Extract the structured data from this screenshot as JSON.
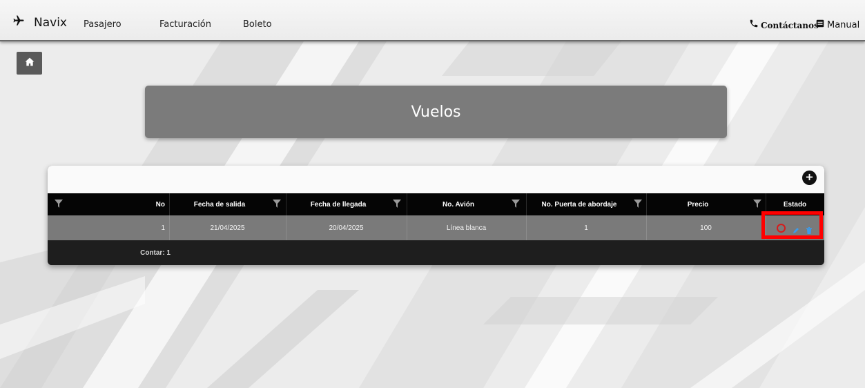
{
  "navbar": {
    "brand": "Navix",
    "links": [
      "Pasajero",
      "Facturación",
      "Boleto"
    ],
    "contact_label": "Contáctanos",
    "manual_label": "Manual"
  },
  "page": {
    "title": "Vuelos"
  },
  "grid": {
    "columns": [
      "No",
      "Fecha de salida",
      "Fecha de llegada",
      "No. Avión",
      "No. Puerta de abordaje",
      "Precio",
      "Estado"
    ],
    "rows": [
      {
        "no": "1",
        "fecha_salida": "21/04/2025",
        "fecha_llegada": "20/04/2025",
        "avion": "Línea blanca",
        "puerta": "1",
        "precio": "100"
      }
    ],
    "footer_count": "Contar: 1"
  },
  "icons": {
    "brand": "airplane-icon",
    "contact": "phone-icon",
    "manual": "book-icon",
    "home": "home-icon",
    "add": "plus-circle-icon",
    "filter": "filter-icon",
    "status": "circle-outline-icon",
    "edit": "pencil-icon",
    "delete": "trash-icon"
  },
  "colors": {
    "status_circle": "#d61c1c",
    "action_blue": "#3d9be9",
    "highlight": "#ff0000",
    "header_bg": "#050505",
    "row_bg": "#7a7a7a",
    "title_bg": "#7b7b7b"
  }
}
